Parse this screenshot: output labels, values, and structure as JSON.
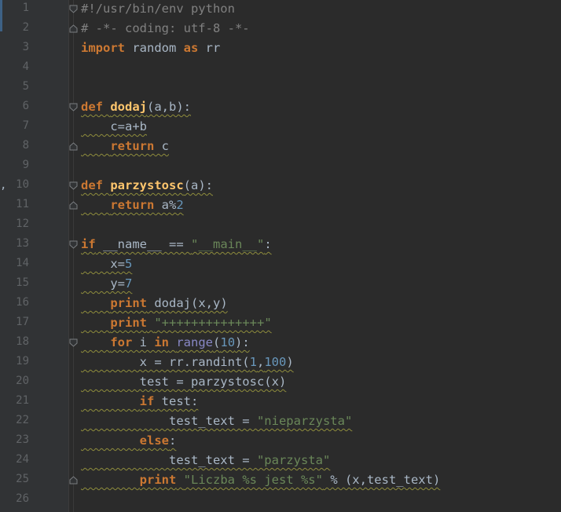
{
  "editor": {
    "lines": [
      {
        "n": "1",
        "fold": "start",
        "tokens": [
          {
            "t": "#!/usr/bin/env python",
            "c": "cm"
          }
        ]
      },
      {
        "n": "2",
        "fold": "end",
        "tokens": [
          {
            "t": "# -*- coding: utf-8 -*-",
            "c": "cm"
          }
        ]
      },
      {
        "n": "3",
        "tokens": [
          {
            "t": "import",
            "c": "kw"
          },
          {
            "t": " random ",
            "c": ""
          },
          {
            "t": "as",
            "c": "kw"
          },
          {
            "t": " rr",
            "c": ""
          }
        ]
      },
      {
        "n": "4",
        "tokens": []
      },
      {
        "n": "5",
        "tokens": []
      },
      {
        "n": "6",
        "fold": "start",
        "tokens": [
          {
            "t": "def",
            "c": "kw"
          },
          {
            "t": " ",
            "c": ""
          },
          {
            "t": "dodaj",
            "c": "fn"
          },
          {
            "t": "(a,b):",
            "c": ""
          }
        ]
      },
      {
        "n": "7",
        "tokens": [
          {
            "t": "    c=a+b",
            "c": ""
          }
        ]
      },
      {
        "n": "8",
        "fold": "end",
        "tokens": [
          {
            "t": "    ",
            "c": ""
          },
          {
            "t": "return",
            "c": "kw"
          },
          {
            "t": " c",
            "c": ""
          }
        ]
      },
      {
        "n": "9",
        "tokens": []
      },
      {
        "n": "10",
        "fold": "start",
        "tokens": [
          {
            "t": "def",
            "c": "kw"
          },
          {
            "t": " ",
            "c": ""
          },
          {
            "t": "parzystosc",
            "c": "fn"
          },
          {
            "t": "(a):",
            "c": ""
          }
        ]
      },
      {
        "n": "11",
        "fold": "end",
        "tokens": [
          {
            "t": "    ",
            "c": ""
          },
          {
            "t": "return",
            "c": "kw"
          },
          {
            "t": " a%",
            "c": ""
          },
          {
            "t": "2",
            "c": "num"
          }
        ]
      },
      {
        "n": "12",
        "tokens": []
      },
      {
        "n": "13",
        "fold": "start",
        "tokens": [
          {
            "t": "if",
            "c": "kw"
          },
          {
            "t": " __name__ == ",
            "c": ""
          },
          {
            "t": "\"__main__\"",
            "c": "str"
          },
          {
            "t": ":",
            "c": ""
          }
        ]
      },
      {
        "n": "14",
        "tokens": [
          {
            "t": "    x=",
            "c": ""
          },
          {
            "t": "5",
            "c": "num"
          }
        ]
      },
      {
        "n": "15",
        "tokens": [
          {
            "t": "    y=",
            "c": ""
          },
          {
            "t": "7",
            "c": "num"
          }
        ]
      },
      {
        "n": "16",
        "tokens": [
          {
            "t": "    ",
            "c": ""
          },
          {
            "t": "print",
            "c": "kw"
          },
          {
            "t": " dodaj(x,y)",
            "c": ""
          }
        ]
      },
      {
        "n": "17",
        "tokens": [
          {
            "t": "    ",
            "c": ""
          },
          {
            "t": "print",
            "c": "kw"
          },
          {
            "t": " ",
            "c": ""
          },
          {
            "t": "\"++++++++++++++\"",
            "c": "str"
          }
        ]
      },
      {
        "n": "18",
        "fold": "start",
        "tokens": [
          {
            "t": "    ",
            "c": ""
          },
          {
            "t": "for",
            "c": "kw"
          },
          {
            "t": " i ",
            "c": ""
          },
          {
            "t": "in",
            "c": "kw"
          },
          {
            "t": " ",
            "c": ""
          },
          {
            "t": "range",
            "c": "bi"
          },
          {
            "t": "(",
            "c": ""
          },
          {
            "t": "10",
            "c": "num"
          },
          {
            "t": "):",
            "c": ""
          }
        ]
      },
      {
        "n": "19",
        "tokens": [
          {
            "t": "        x = rr.randint(",
            "c": ""
          },
          {
            "t": "1",
            "c": "num"
          },
          {
            "t": ",",
            "c": ""
          },
          {
            "t": "100",
            "c": "num"
          },
          {
            "t": ")",
            "c": ""
          }
        ]
      },
      {
        "n": "20",
        "tokens": [
          {
            "t": "        test = parzystosc(x)",
            "c": ""
          }
        ]
      },
      {
        "n": "21",
        "tokens": [
          {
            "t": "        ",
            "c": ""
          },
          {
            "t": "if",
            "c": "kw"
          },
          {
            "t": " test:",
            "c": ""
          }
        ]
      },
      {
        "n": "22",
        "tokens": [
          {
            "t": "            test_text = ",
            "c": ""
          },
          {
            "t": "\"nieparzysta\"",
            "c": "str"
          }
        ]
      },
      {
        "n": "23",
        "tokens": [
          {
            "t": "        ",
            "c": ""
          },
          {
            "t": "else",
            "c": "kw"
          },
          {
            "t": ":",
            "c": ""
          }
        ]
      },
      {
        "n": "24",
        "tokens": [
          {
            "t": "            test_text = ",
            "c": ""
          },
          {
            "t": "\"parzysta\"",
            "c": "str"
          }
        ]
      },
      {
        "n": "25",
        "fold": "end",
        "tokens": [
          {
            "t": "        ",
            "c": ""
          },
          {
            "t": "print",
            "c": "kw"
          },
          {
            "t": " ",
            "c": ""
          },
          {
            "t": "\"Liczba %s jest %s\"",
            "c": "str"
          },
          {
            "t": " % (x,test_text)",
            "c": ""
          }
        ]
      },
      {
        "n": "26",
        "tokens": []
      }
    ]
  },
  "colors": {
    "background": "#2b2b2b",
    "gutter": "#313335",
    "keyword": "#cc7832",
    "function": "#ffc66d",
    "string": "#6a8759",
    "number": "#6897bb",
    "comment": "#808080",
    "text": "#a9b7c6",
    "line_number": "#606366"
  },
  "icons": {
    "fold_start": "fold-open-icon",
    "fold_end": "fold-end-icon"
  }
}
